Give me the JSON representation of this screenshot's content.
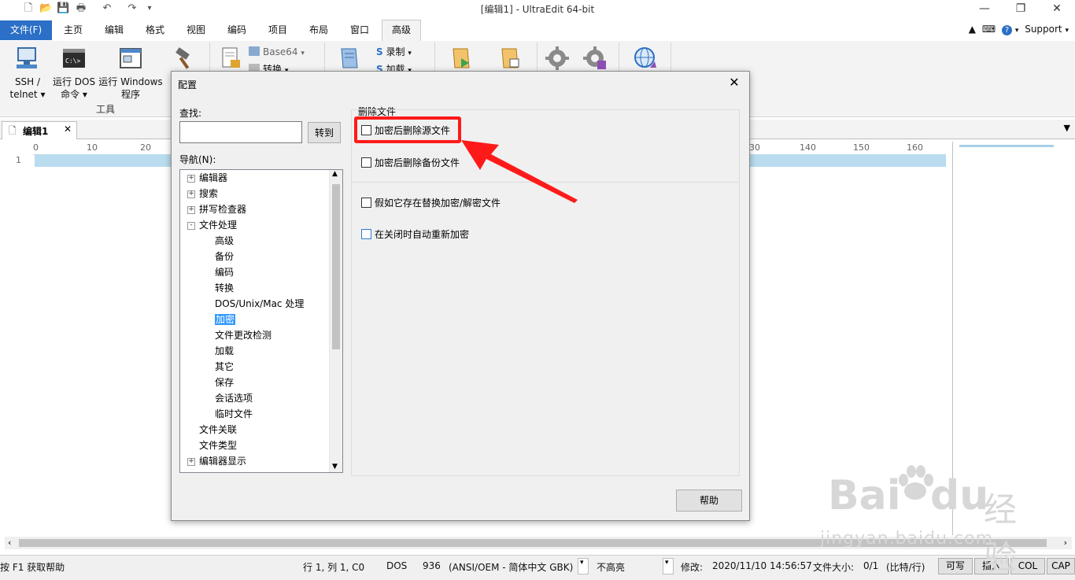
{
  "window": {
    "title": "[编辑1] - UltraEdit 64-bit"
  },
  "ribbon_tabs": [
    "文件(F)",
    "主页",
    "编辑",
    "格式",
    "视图",
    "编码",
    "项目",
    "布局",
    "窗口",
    "高级"
  ],
  "ribbon_right": {
    "support_label": "Support"
  },
  "ribbon": {
    "ssh_label_line1": "SSH /",
    "ssh_label_line2": "telnet",
    "dos_label_line1": "运行 DOS",
    "dos_label_line2": "命令",
    "dos_icon_text": "C:\\>",
    "win_label_line1": "运行 Windows",
    "win_label_line2": "程序",
    "group_tools": "工具",
    "base64_label": "Base64",
    "convert_label": "转换",
    "record_label": "录制",
    "load_label": "加载"
  },
  "doc_tab": {
    "label": "编辑1"
  },
  "editor": {
    "line_number": "1",
    "ruler_left": [
      "0",
      "10",
      "20"
    ],
    "ruler_right": [
      "30",
      "140",
      "150",
      "160"
    ]
  },
  "statusbar": {
    "help_text": "按 F1 获取帮助",
    "position": "行 1, 列 1, C0",
    "line_ending": "DOS",
    "codepage_num": "936",
    "codepage": "(ANSI/OEM - 简体中文 GBK)",
    "highlight": "不高亮",
    "modified_label": "修改:",
    "modified_value": "2020/11/10 14:56:57",
    "filesize_label": "文件大小:",
    "filesize_value": "0/1",
    "filesize_unit": "(比特/行)",
    "btn_write": "可写",
    "btn_insert": "插入",
    "btn_col": "COL",
    "btn_cap": "CAP"
  },
  "dialog": {
    "title": "配置",
    "find_label": "查找:",
    "find_value": "",
    "goto_label": "转到",
    "nav_label": "导航(N):",
    "tree": [
      {
        "label": "编辑器",
        "level": 0,
        "expander": "+"
      },
      {
        "label": "搜索",
        "level": 0,
        "expander": "+"
      },
      {
        "label": "拼写检查器",
        "level": 0,
        "expander": "+"
      },
      {
        "label": "文件处理",
        "level": 0,
        "expander": "-"
      },
      {
        "label": "高级",
        "level": 1
      },
      {
        "label": "备份",
        "level": 1
      },
      {
        "label": "编码",
        "level": 1
      },
      {
        "label": "转换",
        "level": 1
      },
      {
        "label": "DOS/Unix/Mac 处理",
        "level": 1
      },
      {
        "label": "加密",
        "level": 1,
        "selected": true
      },
      {
        "label": "文件更改检测",
        "level": 1
      },
      {
        "label": "加载",
        "level": 1
      },
      {
        "label": "其它",
        "level": 1
      },
      {
        "label": "保存",
        "level": 1
      },
      {
        "label": "会话选项",
        "level": 1
      },
      {
        "label": "临时文件",
        "level": 1
      },
      {
        "label": "文件关联",
        "level": 0
      },
      {
        "label": "文件类型",
        "level": 0
      },
      {
        "label": "编辑器显示",
        "level": 0,
        "expander": "+"
      }
    ],
    "section_title": "删除文件",
    "options": [
      {
        "label": "加密后删除源文件",
        "checked": false
      },
      {
        "label": "加密后删除备份文件",
        "checked": false
      },
      {
        "label": "假如它存在替换加密/解密文件",
        "checked": false
      },
      {
        "label": "在关闭时自动重新加密",
        "checked": false
      }
    ],
    "help_label": "帮助"
  },
  "watermark": {
    "brand": "Bai",
    "brand2": "du",
    "brand_cn": "经验",
    "url": "jingyan.baidu.com"
  },
  "colors": {
    "file_tab": "#2b6fc6",
    "selection": "#3399ff",
    "annotation_red": "#ff1a1a",
    "current_line": "#b9dcef"
  }
}
